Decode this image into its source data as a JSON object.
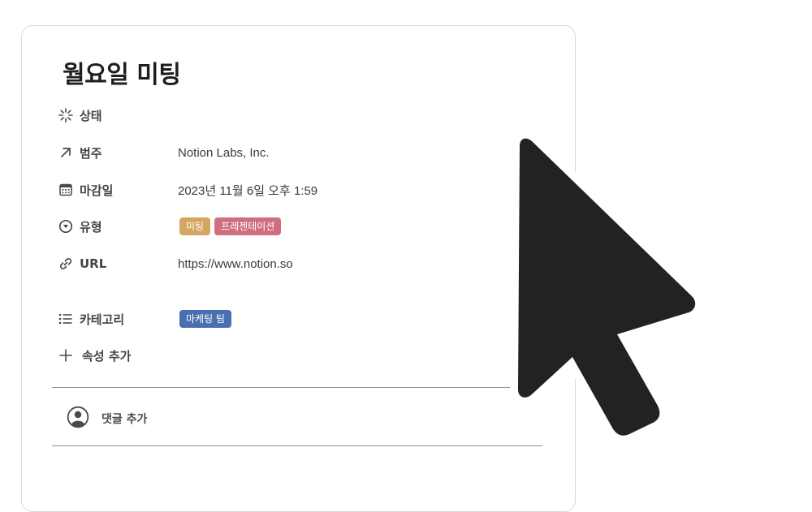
{
  "page": {
    "title": "월요일 미팅"
  },
  "properties": [
    {
      "key": "status",
      "icon": "loading-icon",
      "label": "상태",
      "value": ""
    },
    {
      "key": "category",
      "icon": "arrow-up-right-icon",
      "label": "범주",
      "value": "Notion Labs, Inc."
    },
    {
      "key": "due_date",
      "icon": "calendar-icon",
      "label": "마감일",
      "value": "2023년 11월 6일 오후 1:59"
    },
    {
      "key": "type",
      "icon": "dropdown-circle-icon",
      "label": "유형",
      "tags": [
        {
          "label": "미팅",
          "color": "#d3a762"
        },
        {
          "label": "프레젠테이션",
          "color": "#cf6e80"
        }
      ]
    },
    {
      "key": "url",
      "icon": "link-icon",
      "label": "URL",
      "value": "https://www.notion.so"
    },
    {
      "key": "categories",
      "icon": "list-icon",
      "label": "카테고리",
      "tags": [
        {
          "label": "마케팅 팀",
          "color": "#4a6fb0"
        }
      ]
    }
  ],
  "add_property": {
    "icon": "plus-icon",
    "label": "속성 추가"
  },
  "comment": {
    "icon": "user-avatar-icon",
    "label": "댓글 추가"
  },
  "cursor": {
    "icon": "mouse-pointer-icon",
    "fill": "#222222",
    "outline": "#ffffff"
  }
}
